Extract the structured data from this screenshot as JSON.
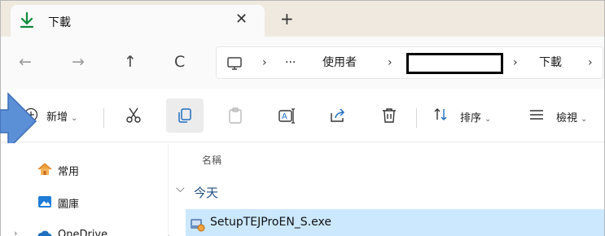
{
  "tab": {
    "title": "下載",
    "close": "✕",
    "new_tab": "+"
  },
  "nav": {
    "back": "←",
    "forward": "→",
    "up": "↑",
    "refresh": "C"
  },
  "address": {
    "more": "···",
    "crumbs": [
      "使用者",
      "下載"
    ],
    "separator": "›"
  },
  "toolbar": {
    "new_label": "新增",
    "sort_label": "排序",
    "view_label": "檢視",
    "chevron": "⌄"
  },
  "sidebar": {
    "items": [
      {
        "label": "常用",
        "icon": "home-icon"
      },
      {
        "label": "圖庫",
        "icon": "gallery-icon"
      },
      {
        "label": "OneDrive",
        "icon": "onedrive-icon"
      }
    ]
  },
  "content": {
    "column_name": "名稱",
    "group_label": "今天",
    "group_chevron": "⌵",
    "files": [
      {
        "name": "SetupTEJProEN_S.exe",
        "icon": "installer-icon"
      }
    ]
  },
  "colors": {
    "accent": "#0f8a3c",
    "selection": "#cce8ff",
    "callout": "#5b8fd6"
  }
}
